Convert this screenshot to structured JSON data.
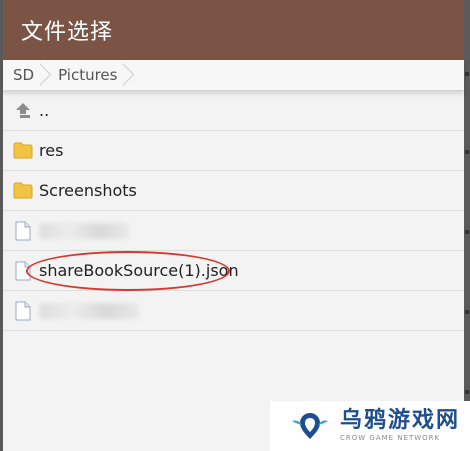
{
  "window": {
    "title": "文件选择"
  },
  "breadcrumbs": [
    {
      "label": "SD"
    },
    {
      "label": "Pictures"
    }
  ],
  "files": [
    {
      "type": "up",
      "name": "..",
      "icon": "up-arrow-icon"
    },
    {
      "type": "folder",
      "name": "res",
      "icon": "folder-icon"
    },
    {
      "type": "folder",
      "name": "Screenshots",
      "icon": "folder-icon"
    },
    {
      "type": "file",
      "name": "",
      "icon": "file-icon",
      "obscured": true
    },
    {
      "type": "file",
      "name": "shareBookSource(1).json",
      "icon": "file-icon",
      "highlighted": true
    },
    {
      "type": "file",
      "name": "",
      "icon": "file-icon",
      "obscured": true
    }
  ],
  "watermark": {
    "title": "乌鸦游戏网",
    "subtitle": "CROW GAME NETWORK"
  },
  "colors": {
    "titlebar": "#7b5446",
    "highlight_ring": "#d33a30",
    "folder": "#f3c343",
    "watermark_blue": "#1f4e8c"
  }
}
